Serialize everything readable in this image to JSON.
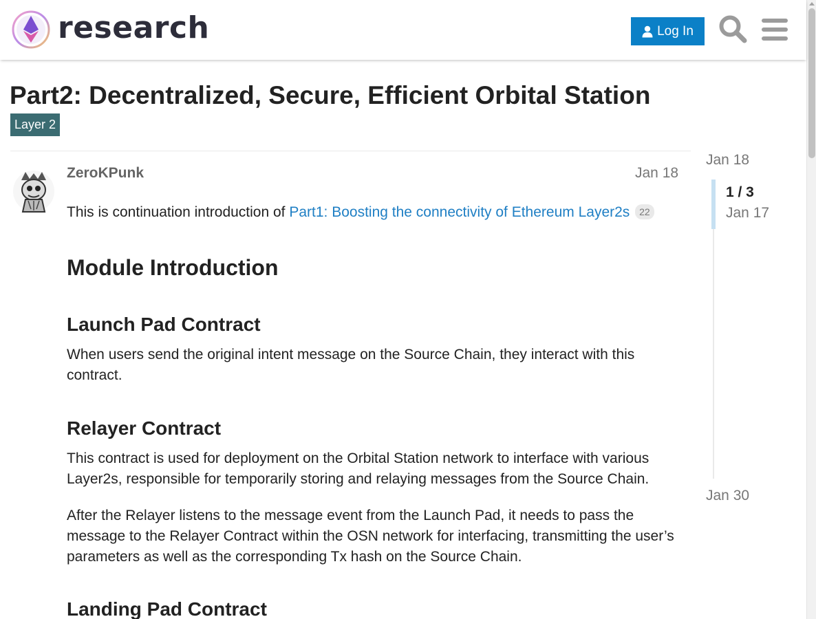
{
  "header": {
    "site_name": "research",
    "login_label": "Log In"
  },
  "topic": {
    "title": "Part2: Decentralized, Secure, Efficient Orbital Station",
    "category": "Layer 2",
    "category_color": "#3b6c72"
  },
  "post": {
    "author": "ZeroKPunk",
    "date": "Jan 18",
    "intro_text": "This is continuation introduction of ",
    "intro_link": "Part1: Boosting the connectivity of Ethereum Layer2s",
    "intro_link_clicks": "22",
    "h_module": "Module Introduction",
    "h_launch": "Launch Pad Contract",
    "p_launch": "When users send the original intent message on the Source Chain, they interact with this contract.",
    "h_relayer": "Relayer Contract",
    "p_relayer_1": "This contract is used for deployment on the Orbital Station network to interface with various Layer2s, responsible for temporarily storing and relaying messages from the Source Chain.",
    "p_relayer_2": "After the Relayer listens to the message event from the Launch Pad, it needs to pass the message to the Relayer Contract within the OSN network for interfacing, transmitting the user’s parameters as well as the corresponding Tx hash on the Source Chain.",
    "h_landing": "Landing Pad Contract"
  },
  "timeline": {
    "start_date": "Jan 18",
    "position": "1 / 3",
    "position_date": "Jan 17",
    "end_date": "Jan 30"
  },
  "colors": {
    "login_button": "#0b80c7",
    "link": "#1f7fc4"
  },
  "icons": {
    "login": "user-icon",
    "search": "search-icon",
    "menu": "hamburger-menu-icon"
  }
}
